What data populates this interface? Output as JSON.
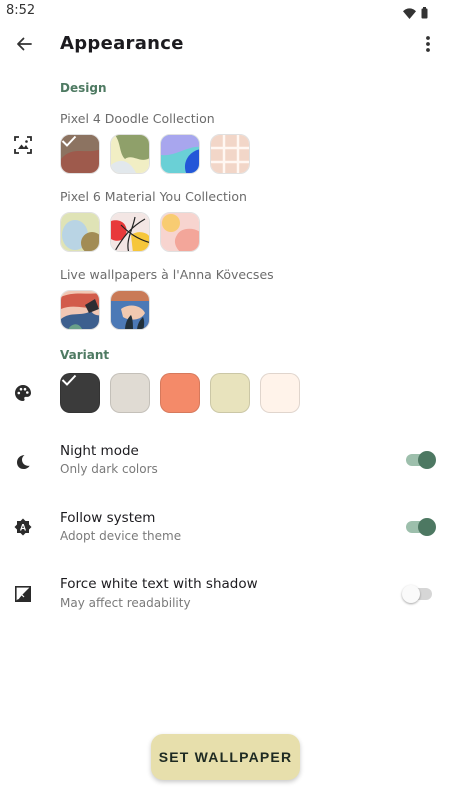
{
  "status_bar": {
    "time": "8:52",
    "icons": [
      "wifi-icon",
      "battery-icon"
    ]
  },
  "app_bar": {
    "title": "Appearance",
    "back_icon": "arrow-back-icon",
    "menu_icon": "more-vert-icon"
  },
  "design": {
    "label": "Design",
    "icon": "wallpaper-icon",
    "collections": [
      {
        "title": "Pixel 4 Doodle Collection",
        "count": 4,
        "selected_index": 0
      },
      {
        "title": "Pixel 6 Material You Collection",
        "count": 3
      },
      {
        "title": "Live wallpapers à l'Anna Kövecses",
        "count": 2
      }
    ]
  },
  "variant": {
    "label": "Variant",
    "icon": "palette-icon",
    "colors": [
      "#3b3b3b",
      "#e0dbd3",
      "#f48a69",
      "#e8e3bd",
      "#fff3ea"
    ],
    "selected_index": 0
  },
  "settings": [
    {
      "title": "Night mode",
      "subtitle": "Only dark colors",
      "enabled": true,
      "icon": "moon-icon"
    },
    {
      "title": "Follow system",
      "subtitle": "Adopt device theme",
      "enabled": true,
      "icon": "auto-mode-icon"
    },
    {
      "title": "Force white text with shadow",
      "subtitle": "May affect readability",
      "enabled": false,
      "icon": "contrast-icon"
    }
  ],
  "fab": {
    "label": "SET WALLPAPER"
  },
  "colors": {
    "accent": "#4d7862",
    "section_label": "#4e7a62",
    "fab_bg": "#e7dfac"
  }
}
